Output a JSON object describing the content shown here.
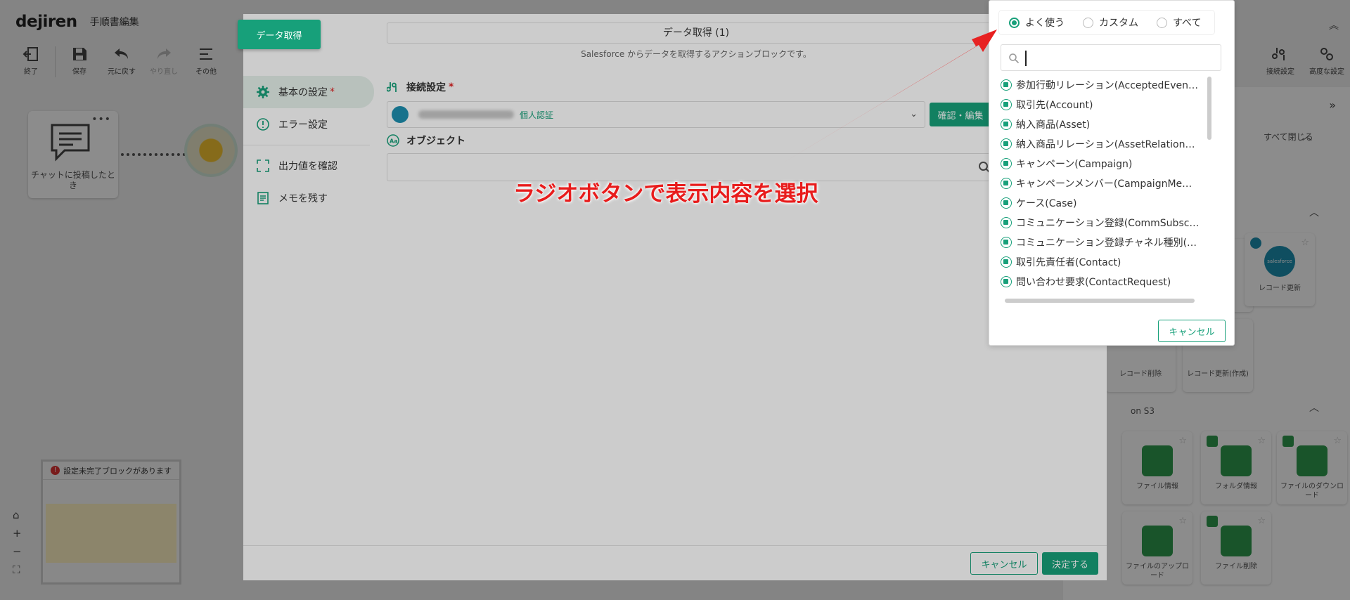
{
  "app": {
    "logo": "dejiren",
    "title": "手順書編集",
    "toolbar": [
      {
        "icon": "exit-icon",
        "label": "終了",
        "enabled": true
      },
      {
        "icon": "save-icon",
        "label": "保存",
        "enabled": true
      },
      {
        "icon": "undo-icon",
        "label": "元に戻す",
        "enabled": true
      },
      {
        "icon": "redo-icon",
        "label": "やり直し",
        "enabled": false
      },
      {
        "icon": "menu-icon",
        "label": "その他",
        "enabled": true
      }
    ],
    "right_toolbar": [
      {
        "icon": "connection-settings-icon",
        "label": "接続設定"
      },
      {
        "icon": "advanced-settings-icon",
        "label": "高度な設定"
      }
    ],
    "canvas_block_label": "チャットに投稿したとき",
    "minimap_warning": "設定未完了ブロックがあります"
  },
  "block_panel": {
    "collapse_all": "すべて閉じる",
    "section_s3": "on S3",
    "cards": [
      {
        "label": "レコード削除"
      },
      {
        "label": "レコード更新(作成)"
      },
      {
        "label": "レコード更新"
      },
      {
        "label": "ファイル情報"
      },
      {
        "label": "フォルダ情報"
      },
      {
        "label": "ファイルのダウンロード"
      },
      {
        "label": "ファイルのアップロード"
      },
      {
        "label": "ファイル削除"
      }
    ]
  },
  "modal": {
    "tab_label": "データ取得",
    "title": "データ取得 (1)",
    "subtitle": "Salesforce からデータを取得するアクションブロックです。",
    "nav": [
      {
        "icon": "gear-icon",
        "label": "基本の設定",
        "required": "*",
        "active": true
      },
      {
        "icon": "alert-circle-icon",
        "label": "エラー設定",
        "required": "",
        "active": false
      },
      {
        "icon": "output-check-icon",
        "label": "出力値を確認",
        "required": "",
        "active": false
      },
      {
        "icon": "memo-icon",
        "label": "メモを残す",
        "required": "",
        "active": false
      }
    ],
    "connection_label": "接続設定",
    "connection_required": "*",
    "connection_auth": "個人認証",
    "confirm_edit": "確認・編集",
    "object_label": "オブジェクト",
    "cancel": "キャンセル",
    "submit": "決定する"
  },
  "popover": {
    "radios": [
      {
        "label": "よく使う",
        "checked": true
      },
      {
        "label": "カスタム",
        "checked": false
      },
      {
        "label": "すべて",
        "checked": false
      }
    ],
    "search_value": "",
    "items": [
      "参加行動リレーション(AcceptedEven…",
      "取引先(Account)",
      "納入商品(Asset)",
      "納入商品リレーション(AssetRelation…",
      "キャンペーン(Campaign)",
      "キャンペーンメンバー(CampaignMe…",
      "ケース(Case)",
      "コミュニケーション登録(CommSubsc…",
      "コミュニケーション登録チャネル種別(…",
      "取引先責任者(Contact)",
      "問い合わせ要求(ContactRequest)"
    ],
    "cancel": "キャンセル"
  },
  "annotation": {
    "text": "ラジオボタンで表示内容を選択",
    "color": "#e81c1c"
  },
  "colors": {
    "accent": "#17a07a",
    "required": "#e02020"
  }
}
